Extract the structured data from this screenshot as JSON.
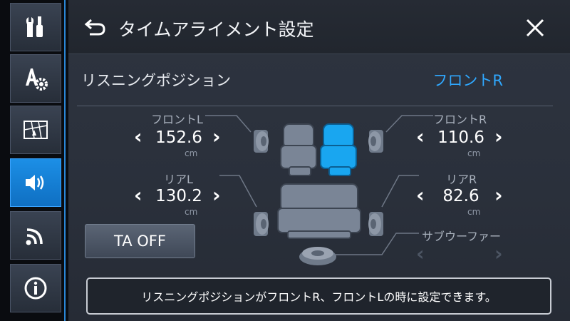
{
  "header": {
    "title": "タイムアライメント設定"
  },
  "listening_position": {
    "label": "リスニングポジション",
    "value": "フロントR"
  },
  "speakers": {
    "front_left": {
      "label": "フロントL",
      "value": "152.6",
      "unit": "cm"
    },
    "front_right": {
      "label": "フロントR",
      "value": "110.6",
      "unit": "cm"
    },
    "rear_left": {
      "label": "リアL",
      "value": "130.2",
      "unit": "cm"
    },
    "rear_right": {
      "label": "リアR",
      "value": "82.6",
      "unit": "cm"
    },
    "subwoofer": {
      "label": "サブウーファー"
    }
  },
  "ta_button": {
    "label": "TA OFF"
  },
  "info_message": "リスニングポジションがフロントR、フロントLの時に設定できます。",
  "arrows": {
    "left": "‹",
    "right": "›"
  },
  "sidebar": {
    "items": [
      {
        "icon": "tools-icon"
      },
      {
        "icon": "settings-icon"
      },
      {
        "icon": "map-icon"
      },
      {
        "icon": "speaker-icon",
        "active": true
      },
      {
        "icon": "wireless-icon"
      },
      {
        "icon": "info-icon"
      }
    ]
  },
  "colors": {
    "accent": "#2fa8ff",
    "active_seat": "#19a6f0",
    "seat": "#7a8596"
  }
}
